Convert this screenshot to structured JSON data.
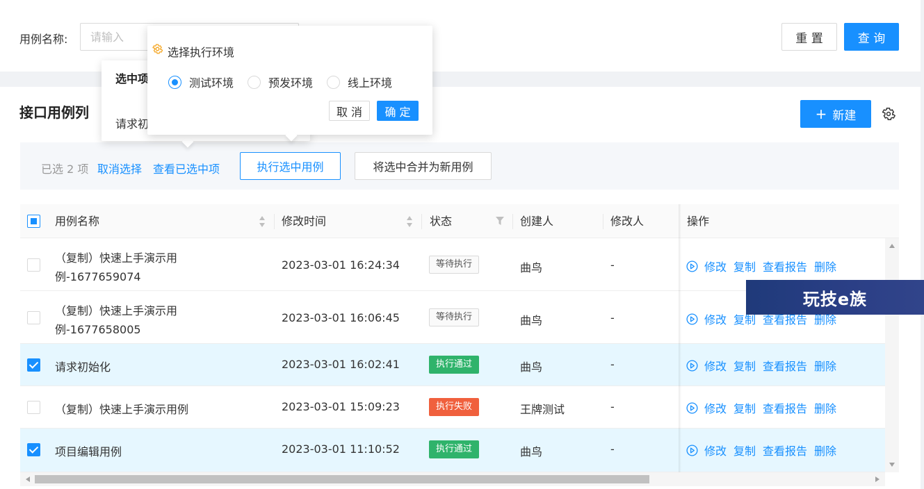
{
  "search": {
    "label": "用例名称:",
    "placeholder": "请输入",
    "reset_label": "重 置",
    "query_label": "查 询"
  },
  "card": {
    "title": "接口用例列",
    "new_label": "新建",
    "new_icon": "plus-icon",
    "settings_icon": "gear-icon"
  },
  "selection": {
    "count_text": "已选 2 项",
    "cancel_label": "取消选择",
    "view_label": "查看已选中项",
    "exec_label": "执行选中用例",
    "merge_label": "将选中合并为新用例"
  },
  "selected_popover": {
    "title": "选中项",
    "item": "请求初"
  },
  "env_popover": {
    "title": "选择执行环境",
    "options": [
      "测试环境",
      "预发环境",
      "线上环境"
    ],
    "selected": "测试环境",
    "cancel_label": "取 消",
    "ok_label": "确 定"
  },
  "table": {
    "columns": [
      "用例名称",
      "修改时间",
      "状态",
      "创建人",
      "修改人",
      "操作"
    ],
    "actions": [
      "修改",
      "复制",
      "查看报告",
      "删除"
    ],
    "rows": [
      {
        "name_line1": "（复制）快速上手演示用",
        "name_line2": "例-1677659074",
        "time": "2023-03-01 16:24:34",
        "status": "等待执行",
        "creator": "曲鸟",
        "modifier": "-"
      },
      {
        "name_line1": "（复制）快速上手演示用",
        "name_line2": "例-1677658005",
        "time": "2023-03-01 16:06:45",
        "status": "等待执行",
        "creator": "曲鸟",
        "modifier": "-"
      },
      {
        "name_line1": "请求初始化",
        "name_line2": "",
        "time": "2023-03-01 16:02:41",
        "status": "执行通过",
        "creator": "曲鸟",
        "modifier": "-"
      },
      {
        "name_line1": "（复制）快速上手演示用例",
        "name_line2": "",
        "time": "2023-03-01 15:09:23",
        "status": "执行失败",
        "creator": "王牌测试",
        "modifier": "-"
      },
      {
        "name_line1": "项目编辑用例",
        "name_line2": "",
        "time": "2023-03-01 11:10:52",
        "status": "执行通过",
        "creator": "曲鸟",
        "modifier": "-"
      }
    ]
  },
  "colors": {
    "primary": "#1890ff",
    "pass": "#2fb36b",
    "fail": "#f0603d",
    "selected_row": "#e6f7ff"
  },
  "watermark": "玩技e族"
}
